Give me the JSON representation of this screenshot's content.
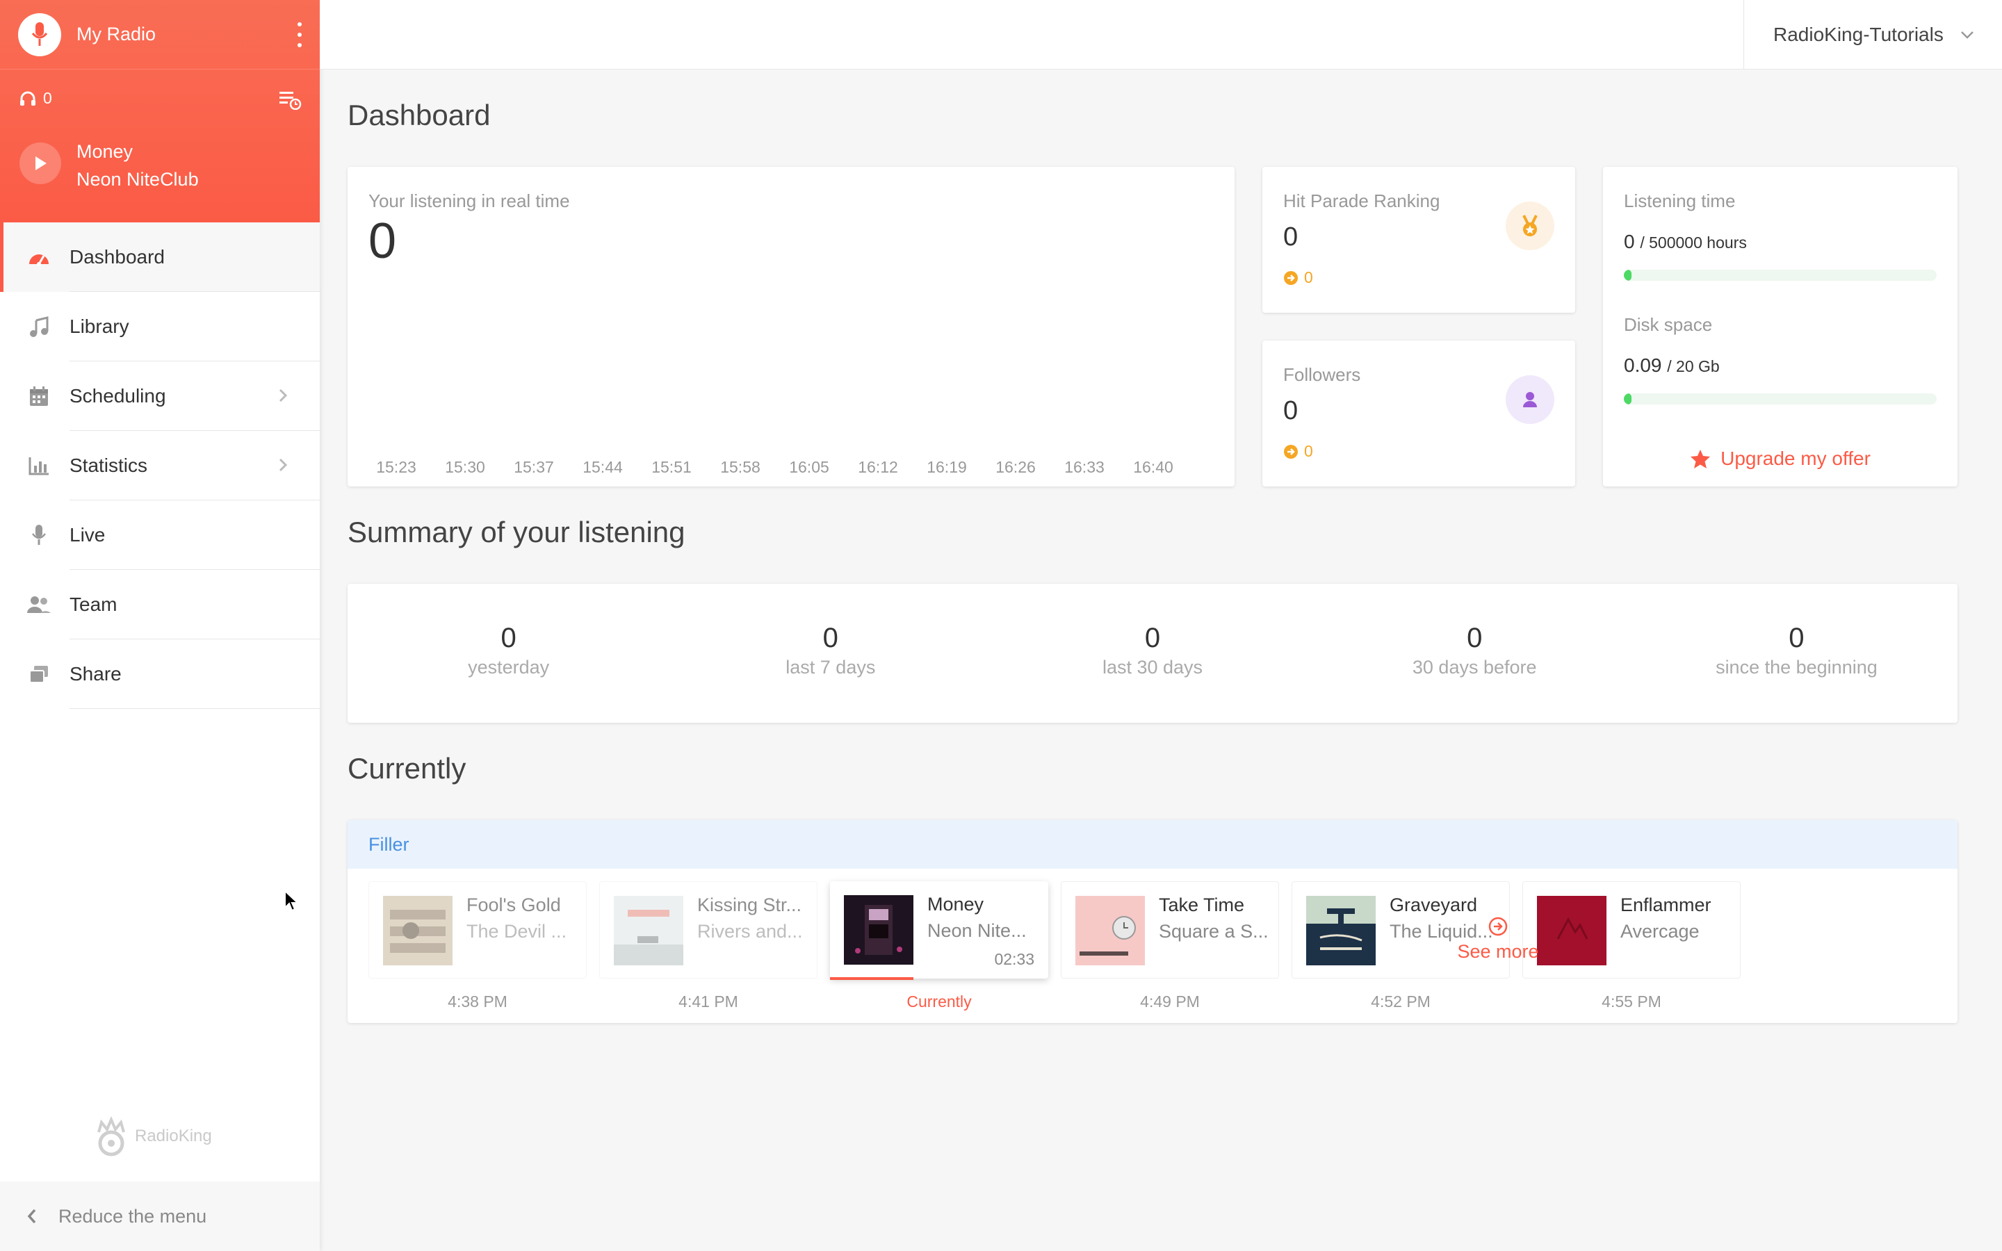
{
  "sidebar": {
    "radio_name": "My Radio",
    "listeners": "0",
    "now_playing": {
      "title": "Money",
      "artist": "Neon NiteClub"
    },
    "items": [
      {
        "label": "Dashboard"
      },
      {
        "label": "Library"
      },
      {
        "label": "Scheduling"
      },
      {
        "label": "Statistics"
      },
      {
        "label": "Live"
      },
      {
        "label": "Team"
      },
      {
        "label": "Share"
      }
    ],
    "brand": "RadioKing",
    "reduce_label": "Reduce the menu"
  },
  "topbar": {
    "account": "RadioKing-Tutorials"
  },
  "dashboard": {
    "title": "Dashboard",
    "realtime": {
      "label": "Your listening in real time",
      "value": "0"
    },
    "hit_parade": {
      "label": "Hit Parade Ranking",
      "value": "0",
      "sub": "0"
    },
    "followers": {
      "label": "Followers",
      "value": "0",
      "sub": "0"
    },
    "usage": {
      "listening_label": "Listening time",
      "listening_value": "0",
      "listening_max": "/ 500000 hours",
      "listening_fraction": 0.0,
      "disk_label": "Disk space",
      "disk_value": "0.09",
      "disk_max": "/ 20 Gb",
      "disk_fraction": 0.0045,
      "upgrade_label": "Upgrade my offer"
    }
  },
  "chart_data": {
    "type": "line",
    "x": [
      "15:23",
      "15:30",
      "15:37",
      "15:44",
      "15:51",
      "15:58",
      "16:05",
      "16:12",
      "16:19",
      "16:26",
      "16:33",
      "16:40"
    ],
    "series": [
      {
        "values": [
          0,
          0,
          0,
          0,
          0,
          0,
          0,
          0,
          0,
          0,
          0,
          0
        ]
      }
    ],
    "grid": false,
    "colors": [
      "#4a90e2",
      "#50e3c2"
    ]
  },
  "summary": {
    "title": "Summary of your listening",
    "items": [
      {
        "value": "0",
        "label": "yesterday"
      },
      {
        "value": "0",
        "label": "last 7 days"
      },
      {
        "value": "0",
        "label": "last 30 days"
      },
      {
        "value": "0",
        "label": "30 days before"
      },
      {
        "value": "0",
        "label": "since the beginning"
      }
    ]
  },
  "currently": {
    "title": "Currently",
    "playlist": "Filler",
    "tracks": [
      {
        "title": "Fool's Gold",
        "artist": "The Devil ...",
        "time": "4:38 PM"
      },
      {
        "title": "Kissing Str...",
        "artist": "Rivers and...",
        "time": "4:41 PM"
      },
      {
        "title": "Money",
        "artist": "Neon Nite...",
        "duration": "02:33",
        "time": "Currently"
      },
      {
        "title": "Take Time",
        "artist": "Square a S...",
        "time": "4:49 PM"
      },
      {
        "title": "Graveyard",
        "artist": "The Liquid...",
        "time": "4:52 PM"
      },
      {
        "title": "Enflammer",
        "artist": "Avercage",
        "time": "4:55 PM"
      }
    ],
    "see_more": "See more"
  },
  "colors": {
    "accent": "#fb5b46",
    "progress": "#4cd964",
    "link": "#4a90e2"
  }
}
